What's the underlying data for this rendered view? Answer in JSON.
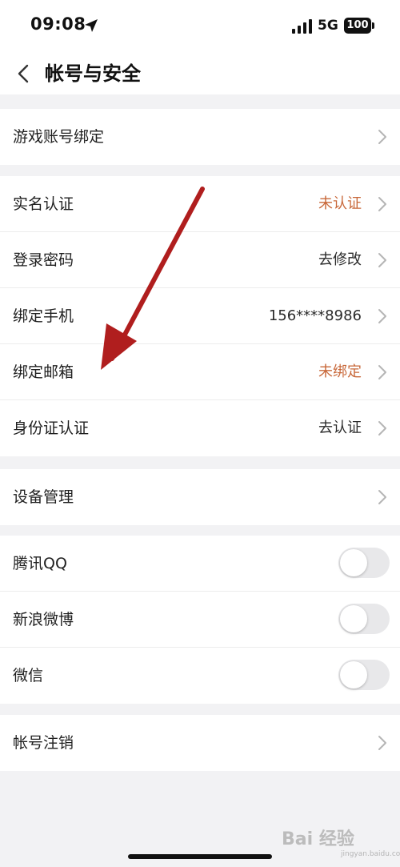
{
  "status_bar": {
    "time": "09:08",
    "network": "5G",
    "battery": "100"
  },
  "nav": {
    "title": "帐号与安全"
  },
  "groups": [
    {
      "rows": [
        {
          "label": "游戏账号绑定"
        }
      ]
    },
    {
      "rows": [
        {
          "label": "实名认证",
          "value": "未认证"
        },
        {
          "label": "登录密码",
          "value": "去修改"
        },
        {
          "label": "绑定手机",
          "value": "156****8986"
        },
        {
          "label": "绑定邮箱",
          "value": "未绑定"
        },
        {
          "label": "身份证认证",
          "value": "去认证"
        }
      ]
    },
    {
      "rows": [
        {
          "label": "设备管理"
        }
      ]
    },
    {
      "rows": [
        {
          "label": "腾讯QQ",
          "toggle_on": false
        },
        {
          "label": "新浪微博",
          "toggle_on": false
        },
        {
          "label": "微信",
          "toggle_on": false
        }
      ]
    },
    {
      "rows": [
        {
          "label": "帐号注销"
        }
      ]
    }
  ],
  "colors": {
    "warning_text": "#c8683a",
    "annotation_arrow": "#b01e1e"
  },
  "watermark": {
    "text": "Bai 经验",
    "sub": "jingyan.baidu.com"
  }
}
